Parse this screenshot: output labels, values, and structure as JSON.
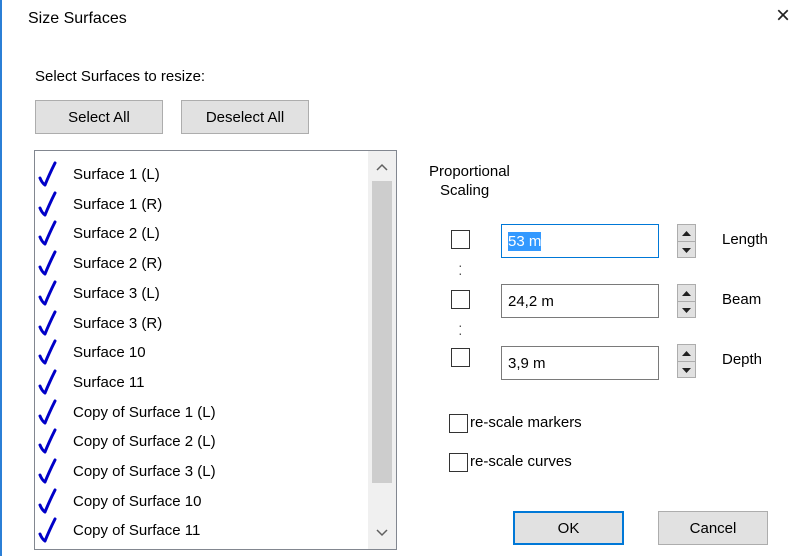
{
  "window": {
    "title": "Size Surfaces",
    "close_glyph": "×"
  },
  "select_prompt": "Select Surfaces to resize:",
  "buttons": {
    "select_all": "Select All",
    "deselect_all": "Deselect All",
    "ok": "OK",
    "cancel": "Cancel"
  },
  "surfaces": [
    {
      "label": "Surface 1 (L)",
      "checked": true
    },
    {
      "label": "Surface 1 (R)",
      "checked": true
    },
    {
      "label": "Surface 2 (L)",
      "checked": true
    },
    {
      "label": "Surface 2 (R)",
      "checked": true
    },
    {
      "label": "Surface 3 (L)",
      "checked": true
    },
    {
      "label": "Surface 3 (R)",
      "checked": true
    },
    {
      "label": "Surface 10",
      "checked": true
    },
    {
      "label": "Surface 11",
      "checked": true
    },
    {
      "label": "Copy of Surface 1 (L)",
      "checked": true
    },
    {
      "label": "Copy of Surface 2 (L)",
      "checked": true
    },
    {
      "label": "Copy of Surface 3 (L)",
      "checked": true
    },
    {
      "label": "Copy of Surface 10",
      "checked": true
    },
    {
      "label": "Copy of Surface 11",
      "checked": true
    }
  ],
  "scaling": {
    "heading_line1": "Proportional",
    "heading_line2": "Scaling"
  },
  "dimensions": [
    {
      "label": "Length",
      "value": "53 m",
      "checked": false
    },
    {
      "label": "Beam",
      "value": "24,2 m",
      "checked": false
    },
    {
      "label": "Depth",
      "value": "3,9 m",
      "checked": false
    }
  ],
  "options": {
    "rescale_markers": "re-scale markers",
    "rescale_curves": "re-scale curves"
  },
  "icons": {
    "check": "check-icon",
    "spin_up": "spin-up-icon",
    "spin_down": "spin-down-icon",
    "close": "close-icon"
  },
  "colors": {
    "check": "#0000c8",
    "selection": "#3399ff",
    "focus": "#0078d7"
  }
}
